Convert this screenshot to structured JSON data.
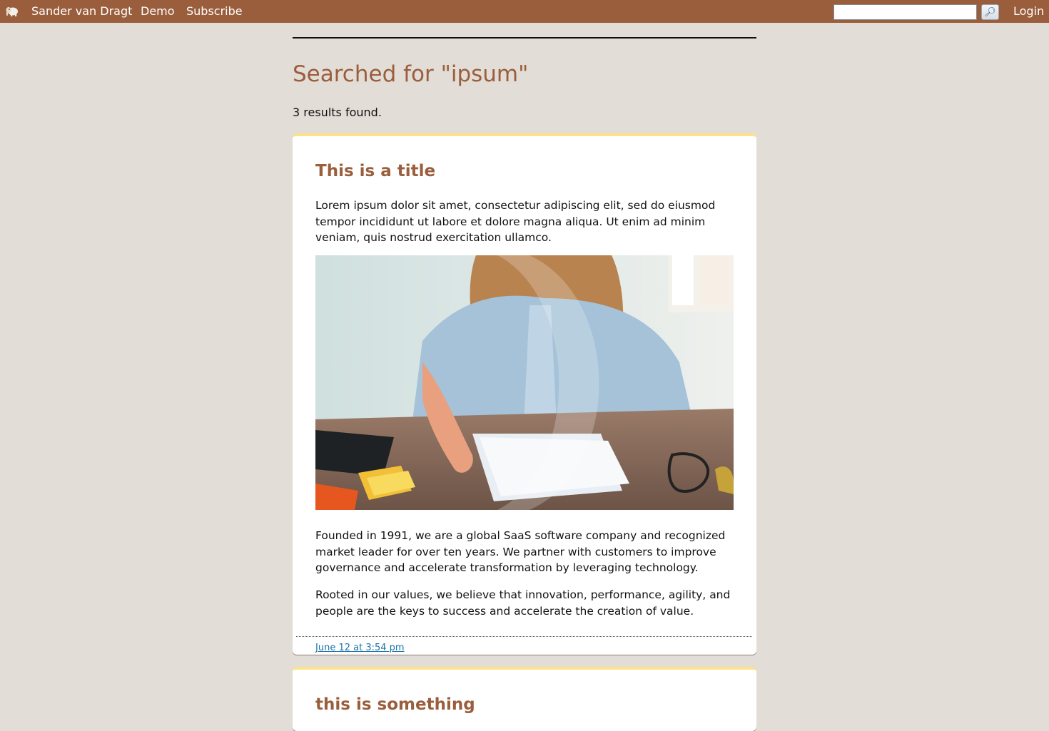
{
  "topbar": {
    "logo_icon": "elephant-icon",
    "links": [
      "Sander van Dragt",
      "Demo",
      "Subscribe"
    ],
    "search_value": "",
    "search_button_icon": "magnifier-icon",
    "login_label": "Login",
    "background_color": "#9a5e3d"
  },
  "main": {
    "title": "Searched for \"ipsum\"",
    "results_count": "3 results found."
  },
  "results": [
    {
      "title": "This is a title",
      "intro": "Lorem ipsum dolor sit amet, consectetur adipiscing elit, sed do eiusmod tempor incididunt ut labore et dolore magna aliqua. Ut enim ad minim veniam, quis nostrud exercitation ullamco.",
      "paragraph_2": "Founded in 1991, we are a global SaaS software company and recognized market leader for over ten years. We partner with customers to improve governance and accelerate transformation by leveraging technology.",
      "paragraph_3": "Rooted in our values, we believe that innovation, performance, agility, and people are the keys to success and accelerate the creation of value.",
      "date": "June 12 at 3:54 pm"
    },
    {
      "title": "this is something"
    }
  ],
  "colors": {
    "accent": "#9a5e3d",
    "card_top_border": "#fde28a",
    "page_background": "#e2ddd7",
    "link": "#1a73a8"
  }
}
